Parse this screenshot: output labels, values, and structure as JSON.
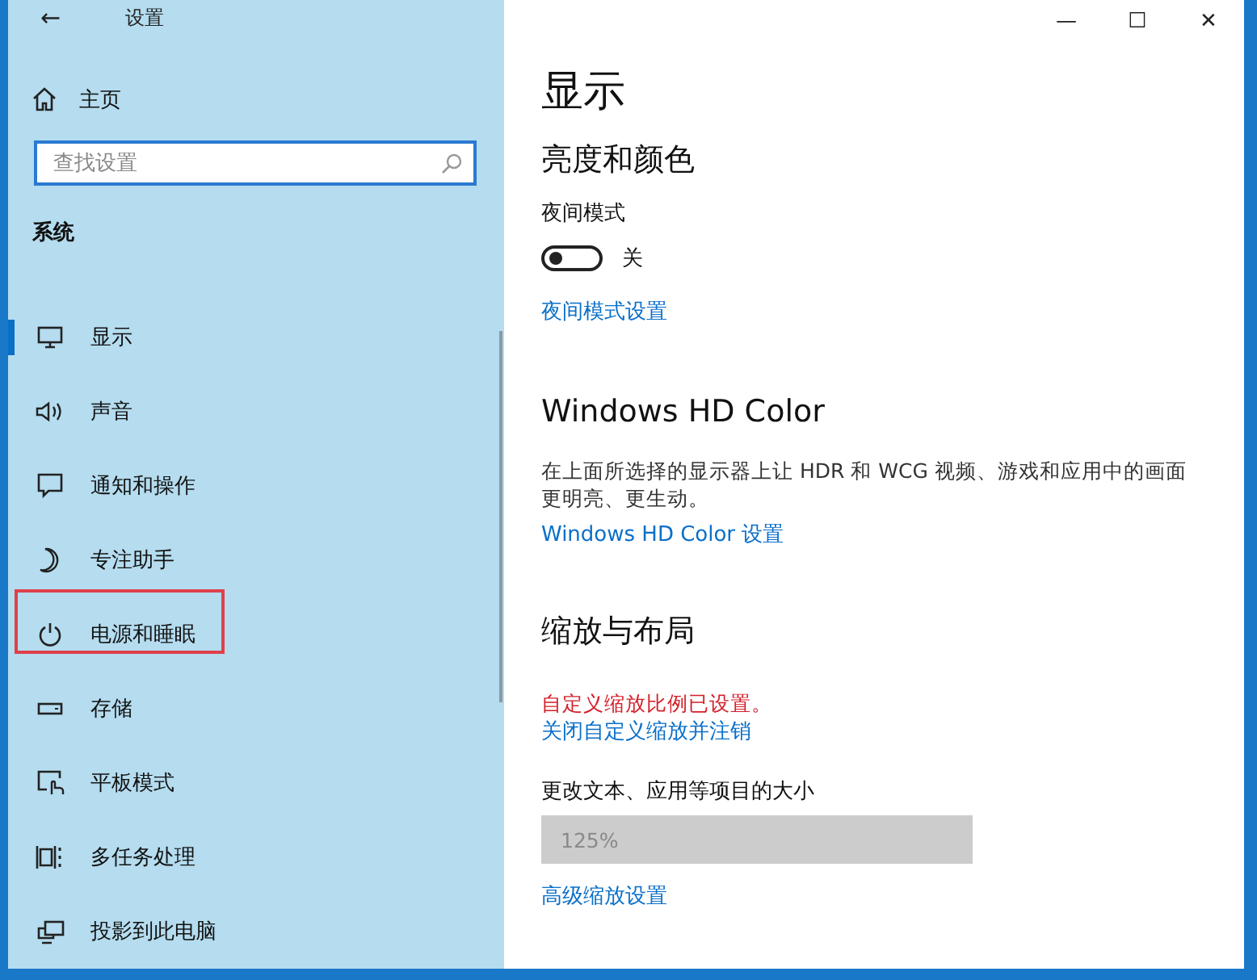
{
  "window": {
    "title": "设置",
    "back": "←",
    "controls": [
      "—",
      "☐",
      "✕"
    ]
  },
  "sidebar": {
    "home": "主页",
    "search": {
      "placeholder": "查找设置"
    },
    "section": "系统",
    "items": [
      {
        "label": "显示",
        "selected": true,
        "annotated": false
      },
      {
        "label": "声音",
        "selected": false,
        "annotated": false
      },
      {
        "label": "通知和操作",
        "selected": false,
        "annotated": false
      },
      {
        "label": "专注助手",
        "selected": false,
        "annotated": false
      },
      {
        "label": "电源和睡眠",
        "selected": false,
        "annotated": true
      },
      {
        "label": "存储",
        "selected": false,
        "annotated": false
      },
      {
        "label": "平板模式",
        "selected": false,
        "annotated": false
      },
      {
        "label": "多任务处理",
        "selected": false,
        "annotated": false
      },
      {
        "label": "投影到此电脑",
        "selected": false,
        "annotated": false
      }
    ]
  },
  "content": {
    "title": "显示",
    "sections": [
      {
        "heading": "亮度和颜色",
        "blocks": [
          {
            "kind": "toggle",
            "label": "夜间模式",
            "on": false,
            "state": "关"
          },
          {
            "kind": "link",
            "text": "夜间模式设置"
          }
        ]
      },
      {
        "heading": "Windows HD Color",
        "blocks": [
          {
            "kind": "text",
            "text": "在上面所选择的显示器上让 HDR 和 WCG 视频、游戏和应用中的画面更明亮、更生动。"
          },
          {
            "kind": "link",
            "text": "Windows HD Color 设置"
          }
        ]
      },
      {
        "heading": "缩放与布局",
        "blocks": [
          {
            "kind": "warning",
            "text": "自定义缩放比例已设置。"
          },
          {
            "kind": "link",
            "text": "关闭自定义缩放并注销"
          },
          {
            "kind": "dropdown",
            "label": "更改文本、应用等项目的大小",
            "value": "125%",
            "disabled": true
          },
          {
            "kind": "link",
            "text": "高级缩放设置"
          }
        ]
      }
    ]
  }
}
